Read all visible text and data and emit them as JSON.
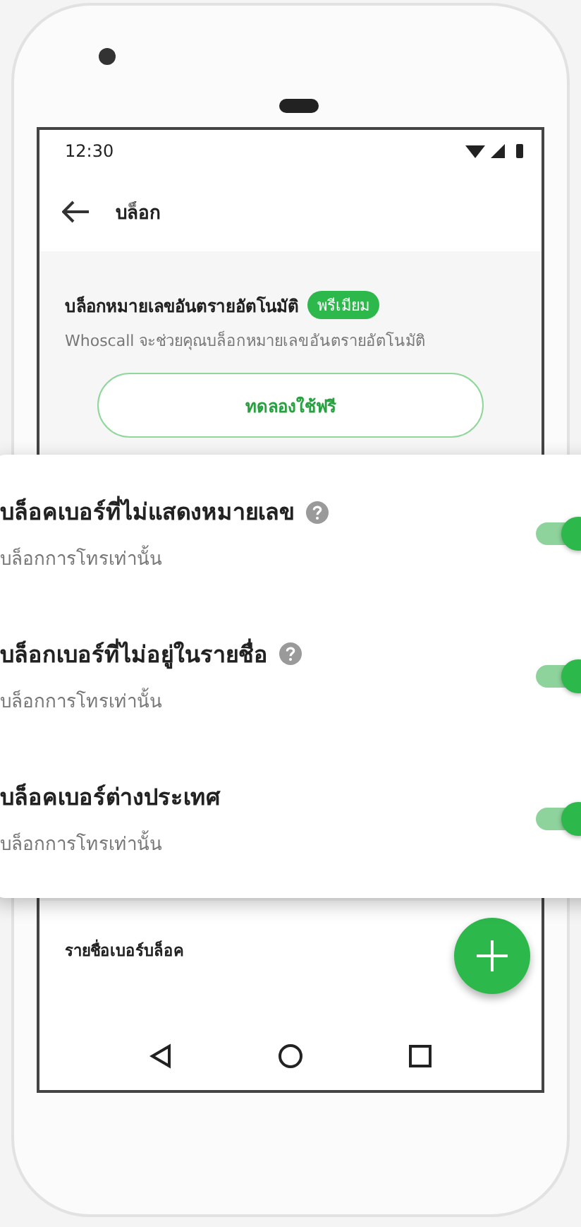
{
  "status_bar": {
    "time": "12:30"
  },
  "app_bar": {
    "title": "บล็อก"
  },
  "promo": {
    "title": "บล็อกหมายเลขอันตรายอัตโนมัติ",
    "badge": "พรีเมียม",
    "description": "Whoscall จะช่วยคุณบล็อกหมายเลขอันตรายอัตโนมัติ",
    "button": "ทดลองใช้ฟรี"
  },
  "settings": [
    {
      "title": "บล็อคเบอร์ที่ไม่แสดงหมายเลข",
      "subtitle": "บล็อกการโทรเท่านั้น",
      "help": true,
      "on": true
    },
    {
      "title": "บล็อกเบอร์ที่ไม่อยู่ในรายชื่อ",
      "subtitle": "บล็อกการโทรเท่านั้น",
      "help": true,
      "on": true
    },
    {
      "title": "บล็อคเบอร์ต่างประเทศ",
      "subtitle": "บล็อกการโทรเท่านั้น",
      "help": false,
      "on": true
    }
  ],
  "blocked_list": {
    "title": "รายชื่อเบอร์บล็อค"
  }
}
